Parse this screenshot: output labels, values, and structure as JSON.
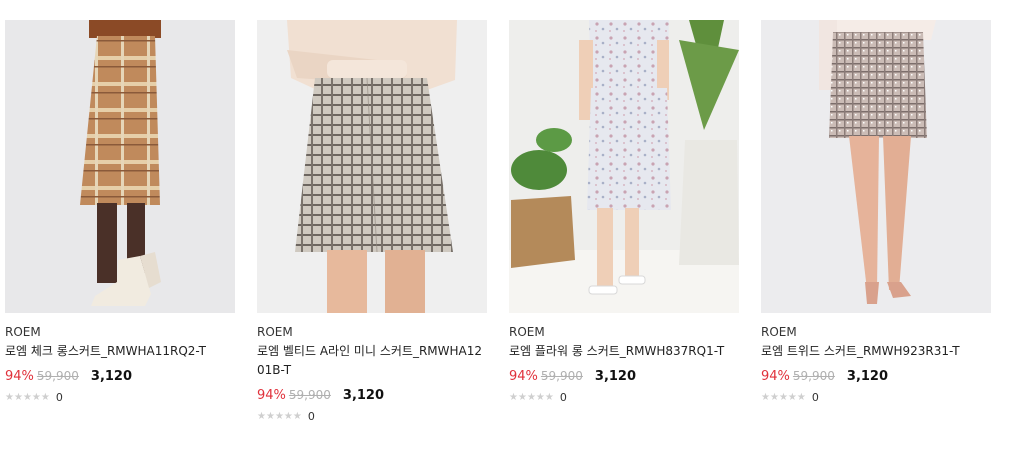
{
  "colors": {
    "discount": "#e0313b",
    "original_price": "#b0b0b0",
    "star_empty": "#cfcfcf"
  },
  "products": [
    {
      "brand": "ROEM",
      "name": "로엠 체크 롱스커트_RMWHA11RQ2-T",
      "discount": "94%",
      "original_price": "59,900",
      "sale_price": "3,120",
      "stars": 0,
      "review_count": "0",
      "image_icon": "plaid-long-skirt"
    },
    {
      "brand": "ROEM",
      "name": "로엠 벨티드 A라인 미니 스커트_RMWHA1201B-T",
      "discount": "94%",
      "original_price": "59,900",
      "sale_price": "3,120",
      "stars": 0,
      "review_count": "0",
      "image_icon": "check-mini-skirt"
    },
    {
      "brand": "ROEM",
      "name": "로엠 플라워 롱 스커트_RMWH837RQ1-T",
      "discount": "94%",
      "original_price": "59,900",
      "sale_price": "3,120",
      "stars": 0,
      "review_count": "0",
      "image_icon": "floral-long-skirt"
    },
    {
      "brand": "ROEM",
      "name": "로엠 트위드 스커트_RMWH923R31-T",
      "discount": "94%",
      "original_price": "59,900",
      "sale_price": "3,120",
      "stars": 0,
      "review_count": "0",
      "image_icon": "tweed-mini-skirt"
    }
  ]
}
